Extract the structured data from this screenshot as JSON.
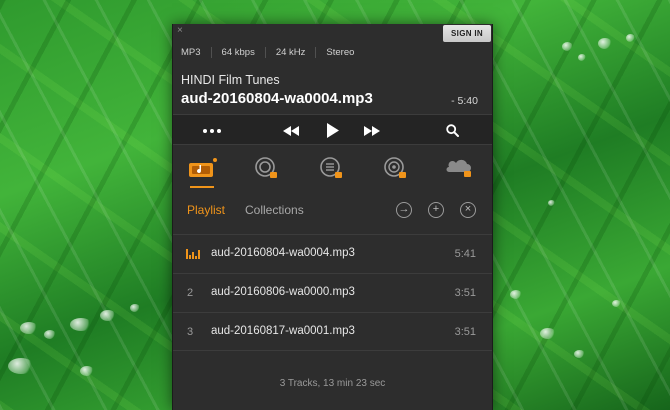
{
  "window": {
    "sign_in_label": "SIGN IN",
    "close_glyph": "×"
  },
  "format": {
    "codec": "MP3",
    "bitrate": "64 kbps",
    "sample_rate": "24 kHz",
    "channels": "Stereo"
  },
  "now_playing": {
    "album": "HINDI Film Tunes",
    "title": "aud-20160804-wa0004.mp3",
    "remaining": "- 5:40"
  },
  "controls": {
    "more_icon": "ellipsis-icon",
    "prev_icon": "rewind-icon",
    "play_icon": "play-icon",
    "next_icon": "fast-forward-icon",
    "search_icon": "search-icon"
  },
  "sources": [
    {
      "icon": "local-music-icon",
      "active": true
    },
    {
      "icon": "network-locked-icon",
      "active": false
    },
    {
      "icon": "library-locked-icon",
      "active": false
    },
    {
      "icon": "podcast-locked-icon",
      "active": false
    },
    {
      "icon": "soundcloud-locked-icon",
      "active": false
    }
  ],
  "tabs": {
    "playlist": "Playlist",
    "collections": "Collections"
  },
  "tab_actions": {
    "go_icon": "arrow-right-circle-icon",
    "add_icon": "plus-circle-icon",
    "clear_icon": "x-circle-icon"
  },
  "playlist": {
    "tracks": [
      {
        "num": "",
        "name": "aud-20160804-wa0004.mp3",
        "duration": "5:41",
        "playing": true
      },
      {
        "num": "2",
        "name": "aud-20160806-wa0000.mp3",
        "duration": "3:51",
        "playing": false
      },
      {
        "num": "3",
        "name": "aud-20160817-wa0001.mp3",
        "duration": "3:51",
        "playing": false
      }
    ],
    "summary": "3 Tracks, 13 min 23 sec"
  },
  "colors": {
    "accent": "#f0941a",
    "panel": "#2d2d2d",
    "controls_bar": "#242424"
  }
}
